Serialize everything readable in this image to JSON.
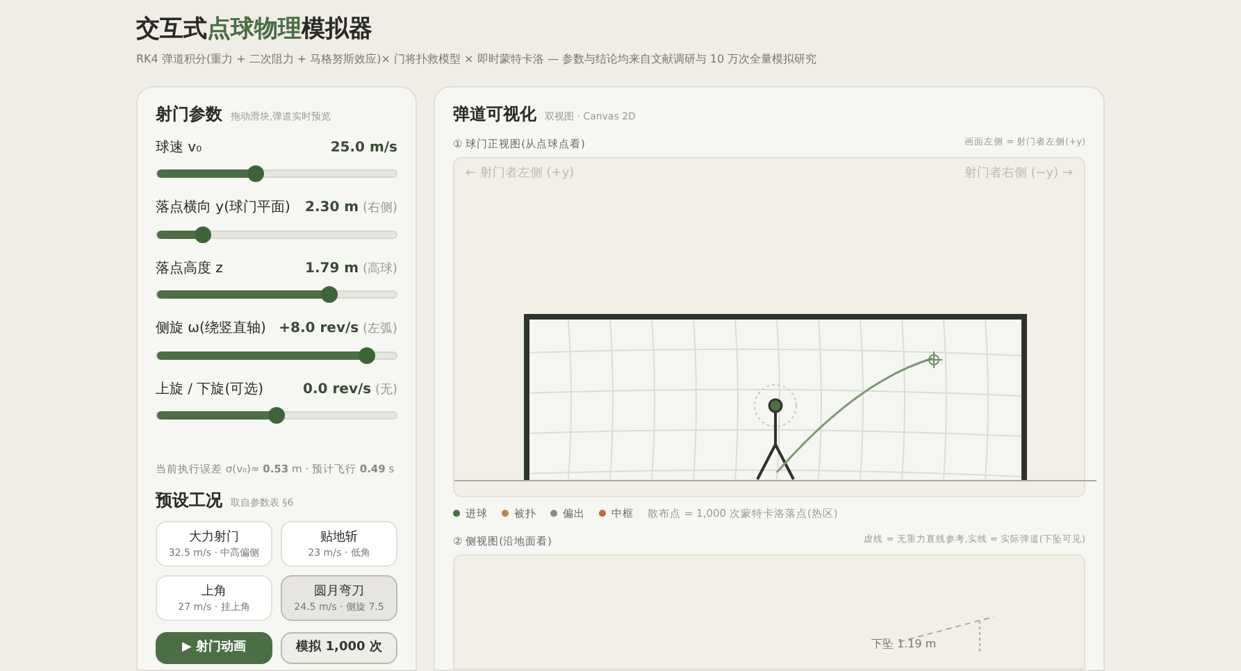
{
  "header": {
    "title_parts": [
      {
        "text": "交互式",
        "accent": false
      },
      {
        "text": "点球物理",
        "accent": true
      },
      {
        "text": "模拟器",
        "accent": false
      }
    ],
    "subtitle": "RK4 弹道积分(重力 + 二次阻力 + 马格努斯效应)× 门将扑救模型 × 即时蒙特卡洛 — 参数与结论均来自文献调研与 10 万次全量模拟研究"
  },
  "params": {
    "title": "射门参数",
    "hint": "拖动滑块,弹道实时预览",
    "sliders": [
      {
        "label": "球速 v₀",
        "value": "25.0 m/s",
        "level": 0.41
      },
      {
        "label": "落点横向 y(球门平面)",
        "value": "2.30 m",
        "note": "(右侧)",
        "level": 0.19
      },
      {
        "label": "落点高度 z",
        "value": "1.79 m",
        "note": "(高球)",
        "level": 0.72
      },
      {
        "label": "侧旋 ω(绕竖直轴)",
        "value": "+8.0 rev/s",
        "note": "(左弧)",
        "level": 0.88
      },
      {
        "label": "上旋 / 下旋(可选)",
        "value": "0.0 rev/s",
        "note": "(无)",
        "level": 0.5
      }
    ],
    "summary": "当前执行误差 σ(v₀)≈ **0.53** m · 预计飞行 **0.49** s"
  },
  "presets": {
    "title": "预设工况",
    "hint": "取自参数表 §6",
    "items": [
      {
        "name": "大力射门",
        "detail": "32.5 m/s · 中高偏侧",
        "selected": false
      },
      {
        "name": "贴地斩",
        "detail": "23 m/s · 低角",
        "selected": false
      },
      {
        "name": "上角",
        "detail": "27 m/s · 挂上角",
        "selected": false
      },
      {
        "name": "圆月弯刀",
        "detail": "24.5 m/s · 侧旋 7.5",
        "selected": true
      }
    ],
    "buttons": [
      {
        "label": "▶ 射门动画",
        "kind": "primary"
      },
      {
        "label": "模拟 1,000 次",
        "kind": "secondary"
      }
    ]
  },
  "viz": {
    "title": "弹道可视化",
    "hint": "双视图 · Canvas 2D",
    "front": {
      "icon": "①",
      "label": "球门正视图(从点球点看)",
      "note": "画面左侧 = 射门者左侧(+y)",
      "left_label": "← 射门者左侧 (+y)",
      "right_label": "射门者右侧 (−y) →"
    },
    "legend": [
      {
        "label": "进球",
        "color": "#4b6e44"
      },
      {
        "label": "被扑",
        "color": "#b8844e"
      },
      {
        "label": "偏出",
        "color": "#8a8a84"
      },
      {
        "label": "中框",
        "color": "#c06a38"
      }
    ],
    "legend_note": "散布点 = 1,000 次蒙特卡洛落点(热区)",
    "side": {
      "icon": "②",
      "label": "侧视图(沿地面看)",
      "note": "虚线 = 无重力直线参考,实线 = 实际弹道(下坠可见)",
      "drop_label": "下坠 1.19 m"
    }
  }
}
